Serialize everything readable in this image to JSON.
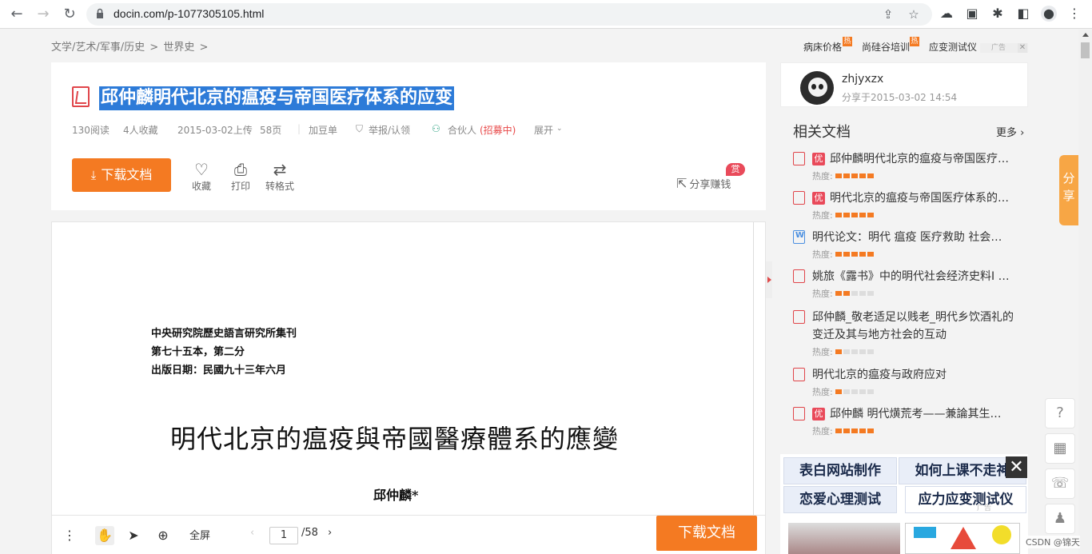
{
  "browser": {
    "url": "docin.com/p-1077305105.html"
  },
  "breadcrumb": [
    "文学/艺术/军事/历史",
    ">",
    "世界史",
    ">"
  ],
  "top_links": {
    "items": [
      "病床价格",
      "尚硅谷培训",
      "应变测试仪"
    ],
    "hot_label": "热",
    "ad_label": "广告",
    "close": "✕"
  },
  "document": {
    "title": "邱仲麟明代北京的瘟疫与帝国医疗体系的应变",
    "meta": {
      "reads": "130阅读",
      "favorites": "4人收藏",
      "uploaded": "2015-03-02上传",
      "pages": "58页",
      "add_to_list": "加豆单",
      "report": "举报/认领",
      "partner": "合伙人",
      "partner_recruit": "(招募中)",
      "expand": "展开"
    },
    "download_label": "下载文档",
    "actions": {
      "favorite": "收藏",
      "print": "打印",
      "convert": "转格式"
    },
    "share_earn": "分享赚钱",
    "reward_badge": "赏"
  },
  "page": {
    "header_lines": [
      "中央研究院歷史語言研究所集刊",
      "第七十五本，第二分",
      "出版日期：民國九十三年六月"
    ],
    "title": "明代北京的瘟疫與帝國醫療體系的應變",
    "author": "邱仲麟*"
  },
  "viewer_toolbar": {
    "fullscreen": "全屏",
    "current_page": "1",
    "total_pages": "/58",
    "download_label": "下载文档"
  },
  "uploader": {
    "name": "zhjyxzx",
    "shared": "分享于2015-03-02 14:54"
  },
  "related": {
    "title": "相关文档",
    "more": "更多",
    "heat_label": "热度:",
    "items": [
      {
        "text": "邱仲麟明代北京的瘟疫与帝国医疗…",
        "badge": "优",
        "type": "pdf",
        "heat": 5
      },
      {
        "text": "明代北京的瘟疫与帝国医疗体系的…",
        "badge": "优",
        "type": "pdf",
        "heat": 5
      },
      {
        "text": "明代论文：明代 瘟疫 医疗救助 社会…",
        "badge": "",
        "type": "word",
        "heat": 5
      },
      {
        "text": "姚旅《露书》中的明代社会经济史料I …",
        "badge": "",
        "type": "pdf",
        "heat": 2
      },
      {
        "text": "邱仲麟_敬老适足以贱老_明代乡饮酒礼的变迁及其与地方社会的互动",
        "badge": "",
        "type": "pdf",
        "heat": 1
      },
      {
        "text": "明代北京的瘟疫与政府应对",
        "badge": "",
        "type": "pdf",
        "heat": 1
      },
      {
        "text": "邱仲麟 明代熿荒考——兼論其生…",
        "badge": "优",
        "type": "pdf",
        "heat": 5
      }
    ]
  },
  "ads": {
    "cells": [
      "表白网站制作",
      "如何上课不走神",
      "恋爱心理测试",
      "应力应变测试仪"
    ],
    "ad_label": "广告"
  },
  "share_tab": [
    "分",
    "享"
  ],
  "watermark": "CSDN @锦天",
  "colors": {
    "accent_orange": "#f47a22",
    "title_highlight": "#2d7bd8",
    "pdf_red": "#e0454a"
  }
}
